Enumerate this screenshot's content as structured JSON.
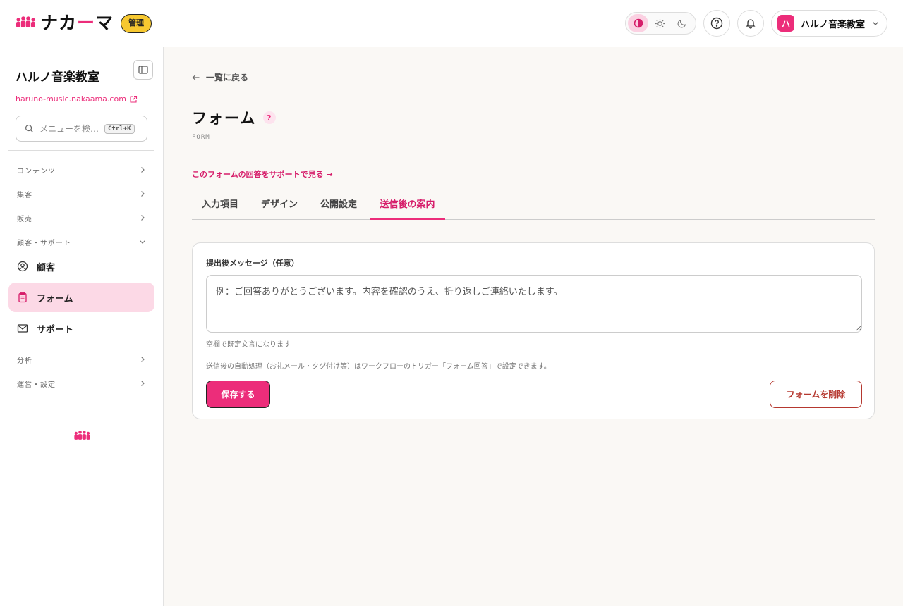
{
  "brand": {
    "logo_text_1": "ナカ",
    "logo_text_dash": "ー",
    "logo_text_2": "マ",
    "admin_badge": "管理",
    "accent": "#ec2d7a"
  },
  "header": {
    "theme_modes": [
      "contrast-icon",
      "sun-icon",
      "moon-icon"
    ],
    "account_initial": "ハ",
    "account_name": "ハルノ音楽教室"
  },
  "sidebar": {
    "school_title": "ハルノ音楽教室",
    "school_url": "haruno-music.nakaama.com",
    "search_placeholder": "メニューを検…",
    "search_shortcut": "Ctrl+K",
    "sections": {
      "contents": "コンテンツ",
      "marketing": "集客",
      "sales": "販売",
      "customer_support": "顧客・サポート",
      "analytics": "分析",
      "operations": "運営・設定"
    },
    "items": {
      "customers": "顧客",
      "forms": "フォーム",
      "support": "サポート"
    }
  },
  "main": {
    "back_link": "一覧に戻る",
    "title": "フォーム",
    "help_mark": "?",
    "subtitle": "FORM",
    "support_link": "このフォームの回答をサポートで見る →",
    "tabs": [
      "入力項目",
      "デザイン",
      "公開設定",
      "送信後の案内"
    ],
    "active_tab": "送信後の案内",
    "form": {
      "message_label": "提出後メッセージ（任意）",
      "message_placeholder": "例：ご回答ありがとうございます。内容を確認のうえ、折り返しご連絡いたします。",
      "message_value": "",
      "hint": "空欄で既定文言になります",
      "note": "送信後の自動処理（お礼メール・タグ付け等）はワークフローのトリガー「フォーム回答」で設定できます。",
      "save_label": "保存する",
      "delete_label": "フォームを削除"
    }
  }
}
